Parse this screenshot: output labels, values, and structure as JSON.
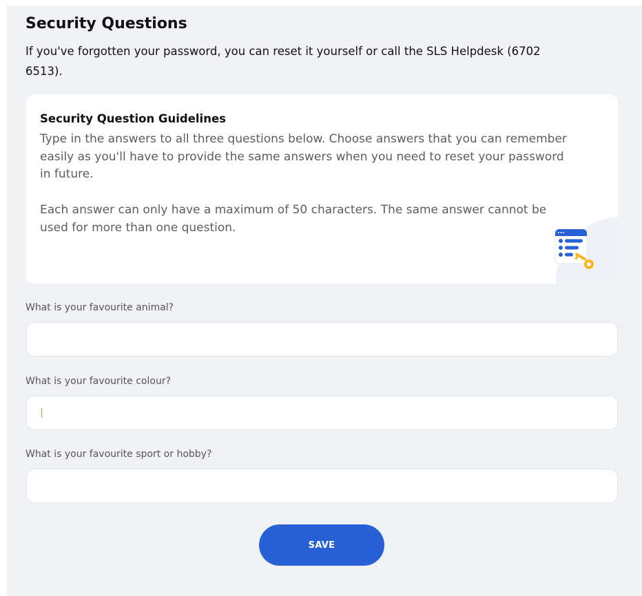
{
  "header": {
    "title": "Security Questions",
    "intro": "If you've forgotten your password, you can reset it yourself or call the SLS Helpdesk (6702 6513)."
  },
  "guidelines": {
    "title": "Security Question Guidelines",
    "paragraph1": "Type in the answers to all three questions below. Choose answers that you can remember easily as you'll have to provide the same answers when you need to reset your password in future.",
    "paragraph2": "Each answer can only have a maximum of 50 characters. The same answer cannot be used for more than one question.",
    "illustration_icon": "security-key-list-icon",
    "colors": {
      "primary": "#2861d6",
      "key": "#f5b524"
    }
  },
  "questions": [
    {
      "label": "What is your favourite animal?",
      "value": "",
      "placeholder": ""
    },
    {
      "label": "What is your favourite colour?",
      "value": "",
      "placeholder": ""
    },
    {
      "label": "What is your favourite sport or hobby?",
      "value": "",
      "placeholder": ""
    }
  ],
  "actions": {
    "save_label": "SAVE",
    "save_color": "#2861d6"
  }
}
